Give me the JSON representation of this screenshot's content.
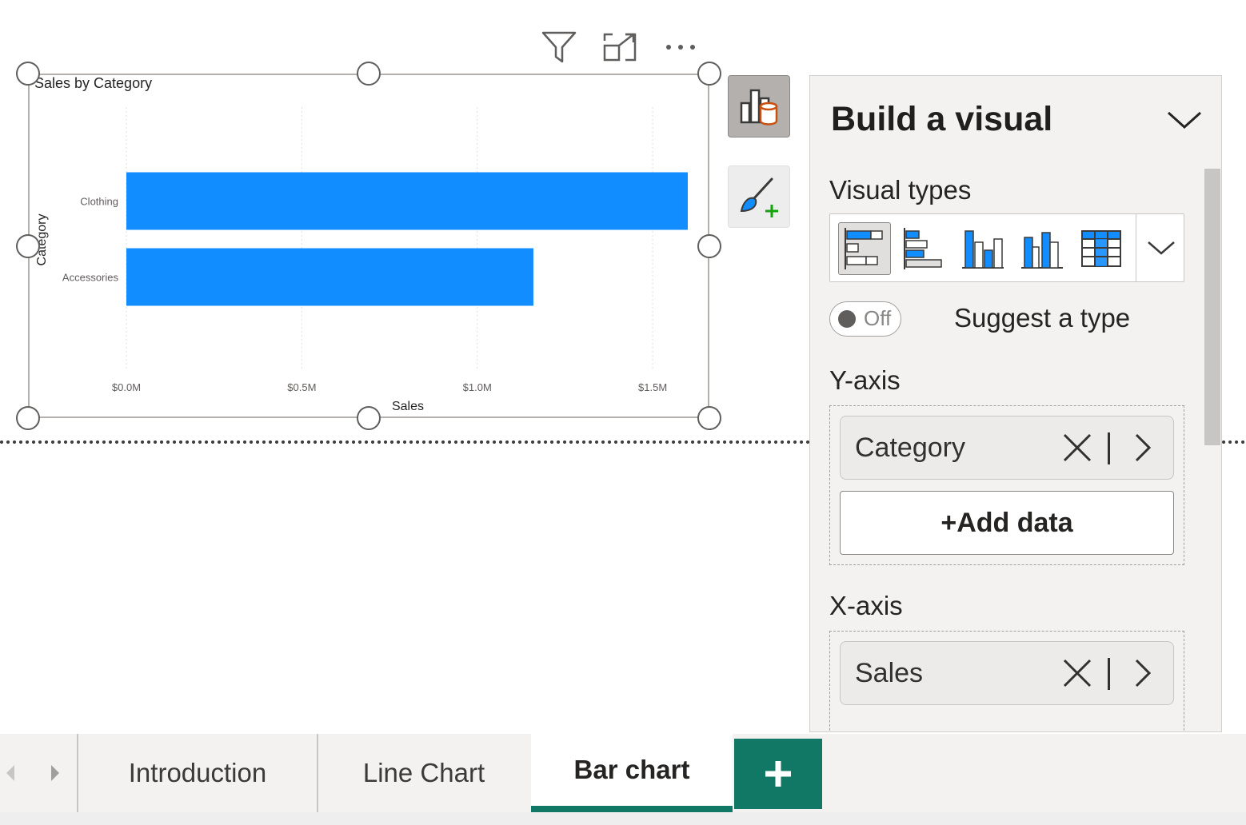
{
  "visual": {
    "title": "Sales by Category"
  },
  "chart_data": {
    "type": "bar",
    "orientation": "horizontal",
    "title": "Sales by Category",
    "categories": [
      "Clothing",
      "Accessories"
    ],
    "values": [
      1.6,
      1.16
    ],
    "value_unit": "$M",
    "xlabel": "Sales",
    "ylabel": "Category",
    "xlim": [
      0,
      1.6
    ],
    "xticks": [
      0,
      0.5,
      1.0,
      1.5
    ],
    "xtick_labels": [
      "$0.0M",
      "$0.5M",
      "$1.0M",
      "$1.5M"
    ],
    "grid": true,
    "legend": "none",
    "bar_color": "#118DFF"
  },
  "header_icons": [
    "filter-icon",
    "focus-mode-icon",
    "more-options-icon"
  ],
  "pane": {
    "title": "Build a visual",
    "visual_types_label": "Visual types",
    "visual_types": [
      "stacked-bar-chart",
      "clustered-bar-chart",
      "stacked-column-chart",
      "clustered-column-chart",
      "table-visual"
    ],
    "toggle_label": "Off",
    "suggest_label": "Suggest a type",
    "y_axis": {
      "label": "Y-axis",
      "field": "Category",
      "add_label": "+Add data"
    },
    "x_axis": {
      "label": "X-axis",
      "field": "Sales"
    }
  },
  "tabs": [
    {
      "label": "Introduction",
      "active": false
    },
    {
      "label": "Line Chart",
      "active": false
    },
    {
      "label": "Bar chart",
      "active": true
    }
  ],
  "colors": {
    "accent": "#117865",
    "bar": "#118DFF",
    "pane_bg": "#F3F2F1"
  }
}
